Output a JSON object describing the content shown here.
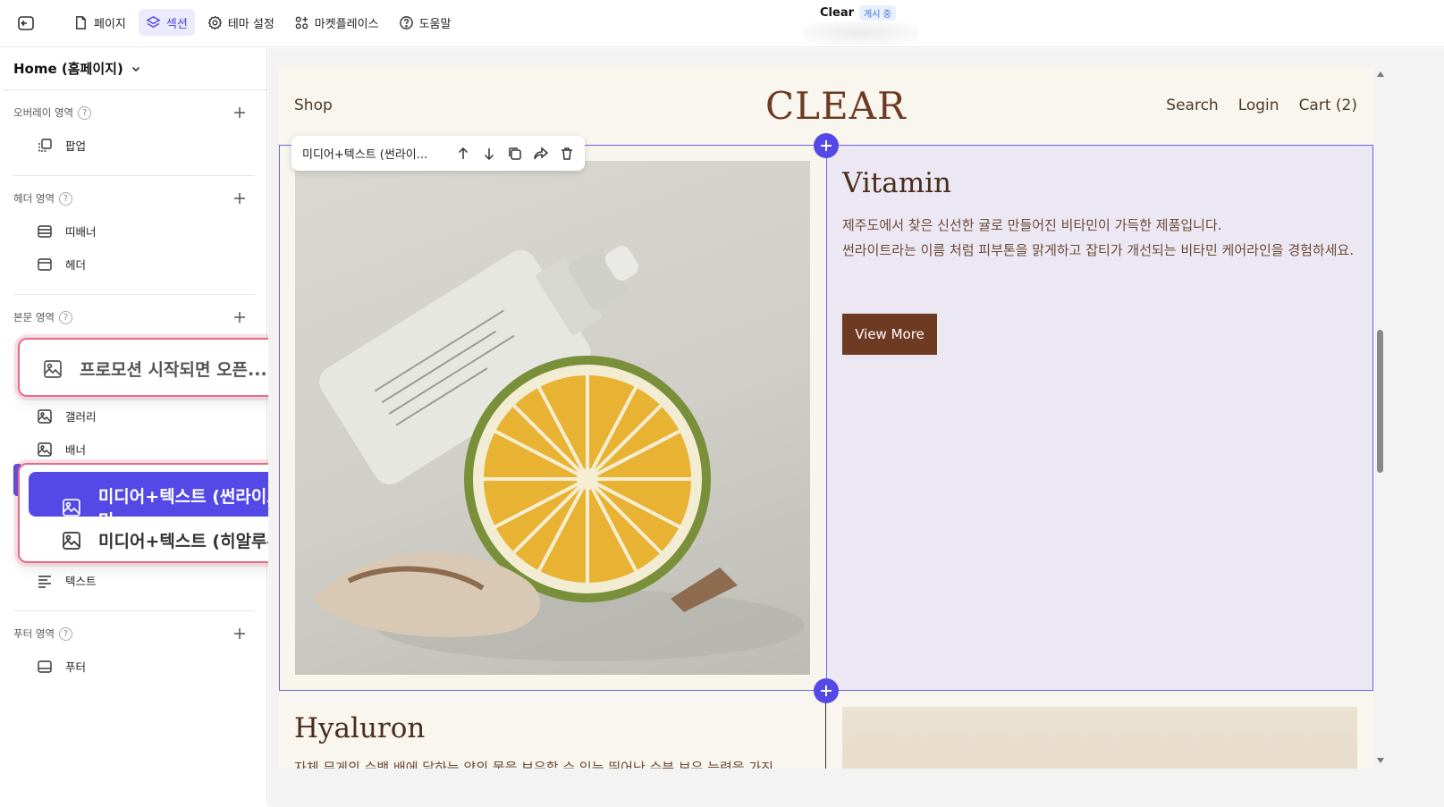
{
  "topbar": {
    "nav": [
      {
        "label": "페이지",
        "icon": "page-icon"
      },
      {
        "label": "섹션",
        "icon": "layers-icon",
        "active": true
      },
      {
        "label": "테마 설정",
        "icon": "gear-icon"
      },
      {
        "label": "마켓플레이스",
        "icon": "apps-icon"
      },
      {
        "label": "도움말",
        "icon": "help-icon"
      }
    ],
    "site_name": "Clear",
    "site_status": "게시 중"
  },
  "sidebar": {
    "page_select": "Home (홈페이지)",
    "regions": {
      "overlay": {
        "title": "오버레이 영역",
        "items": [
          {
            "label": "팝업",
            "icon": "popup-icon"
          }
        ]
      },
      "header": {
        "title": "헤더 영역",
        "items": [
          {
            "label": "띠배너",
            "icon": "banner-strip-icon"
          },
          {
            "label": "헤더",
            "icon": "header-icon"
          }
        ]
      },
      "body": {
        "title": "본문 영역",
        "items": [
          {
            "label": "프로모션 시작되면 오픈...",
            "icon": "image-icon",
            "hidden": true
          },
          {
            "label": "갤러리",
            "icon": "image-icon"
          },
          {
            "label": "배너",
            "icon": "image-icon"
          },
          {
            "label": "미디어+텍스트 (썬라이트비타민...",
            "icon": "image-icon",
            "selected": true
          },
          {
            "label": "미디어+텍스트 (히알루론산스킨)",
            "icon": "image-icon"
          },
          {
            "label": "텍스트",
            "icon": "text-icon"
          }
        ]
      },
      "footer": {
        "title": "푸터 영역",
        "items": [
          {
            "label": "푸터",
            "icon": "footer-icon"
          }
        ]
      }
    }
  },
  "section_toolbar": {
    "label": "미디어+텍스트 (썬라이..."
  },
  "preview": {
    "header": {
      "shop": "Shop",
      "logo": "CLEAR",
      "links": [
        "Search",
        "Login",
        "Cart (2)"
      ]
    },
    "vitamin": {
      "title": "Vitamin",
      "desc_line1": "제주도에서 찾은 신선한 귤로 만들어진 비타민이 가득한 제품입니다.",
      "desc_line2": "썬라이트라는 이름 처럼 피부톤을 맑게하고 잡티가 개선되는 비타민 케어라인을 경험하세요.",
      "button": "View More"
    },
    "hyaluron": {
      "title": "Hyaluron",
      "desc": "자체 무게의 수백 배에 달하는 양의 물을 보유할 수 있는 뛰어난 수분 보유 능력을 가진"
    }
  },
  "colors": {
    "accent": "#5448e6",
    "highlight": "#e86a86",
    "brand": "#6e3a22"
  }
}
